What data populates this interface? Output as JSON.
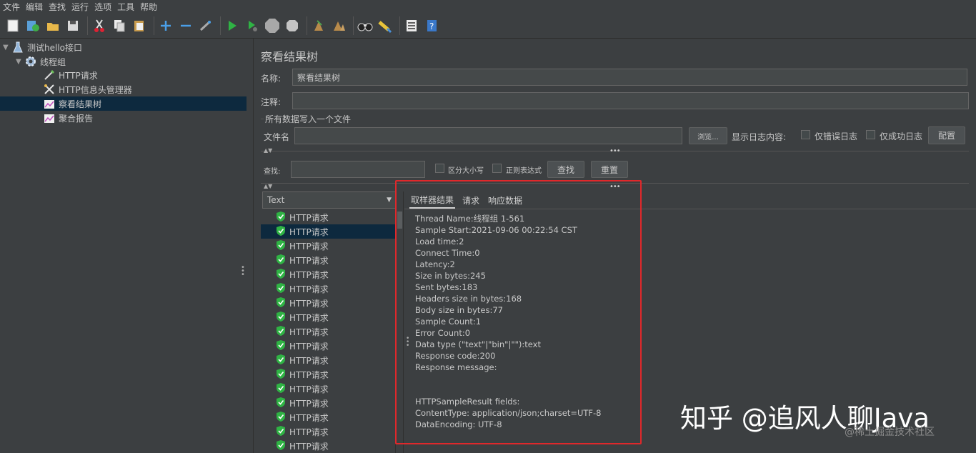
{
  "menu": [
    "文件",
    "编辑",
    "查找",
    "运行",
    "选项",
    "工具",
    "帮助"
  ],
  "toolbar_icons": [
    "new-icon",
    "templates-icon",
    "open-icon",
    "save-icon",
    "cut-icon",
    "copy-icon",
    "paste-icon",
    "expand-icon",
    "collapse-icon",
    "toggle-icon",
    "start-icon",
    "start-no-pause-icon",
    "stop-icon",
    "shutdown-icon",
    "clear-icon",
    "clear-all-icon",
    "search-icon",
    "reset-search-icon",
    "function-helper-icon",
    "help-icon"
  ],
  "tree": {
    "root": "测试hello接口",
    "thread_group": "线程组",
    "items": [
      "HTTP请求",
      "HTTP信息头管理器",
      "察看结果树",
      "聚合报告"
    ]
  },
  "panel": {
    "title": "察看结果树",
    "name_label": "名称:",
    "name_value": "察看结果树",
    "comment_label": "注释:",
    "comment_value": "",
    "write_all_label": "所有数据写入一个文件",
    "filename_label": "文件名",
    "filename_value": "",
    "browse_label": "浏览...",
    "log_label": "显示日志内容:",
    "errors_only_label": "仅错误日志",
    "success_only_label": "仅成功日志",
    "config_label": "配置"
  },
  "search": {
    "label": "查找:",
    "value": "",
    "case_label": "区分大小写",
    "regex_label": "正则表达式",
    "find_button": "查找",
    "reset_button": "重置"
  },
  "renderer": {
    "selected": "Text"
  },
  "samples": [
    "HTTP请求",
    "HTTP请求",
    "HTTP请求",
    "HTTP请求",
    "HTTP请求",
    "HTTP请求",
    "HTTP请求",
    "HTTP请求",
    "HTTP请求",
    "HTTP请求",
    "HTTP请求",
    "HTTP请求",
    "HTTP请求",
    "HTTP请求",
    "HTTP请求",
    "HTTP请求",
    "HTTP请求"
  ],
  "selected_sample_index": 1,
  "result_tabs": [
    "取样器结果",
    "请求",
    "响应数据"
  ],
  "result_lines": [
    "Thread Name:线程组 1-561",
    "Sample Start:2021-09-06 00:22:54 CST",
    "Load time:2",
    "Connect Time:0",
    "Latency:2",
    "Size in bytes:245",
    "Sent bytes:183",
    "Headers size in bytes:168",
    "Body size in bytes:77",
    "Sample Count:1",
    "Error Count:0",
    "Data type (\"text\"|\"bin\"|\"\"):text",
    "Response code:200",
    "Response message:",
    "",
    "",
    "HTTPSampleResult fields:",
    "ContentType: application/json;charset=UTF-8",
    "DataEncoding: UTF-8"
  ],
  "watermark": {
    "main": "知乎 @追风人聊Java",
    "sub": "@稀土掘金技术社区"
  },
  "colors": {
    "background": "#3c3f41",
    "selection": "#0d293e",
    "highlight_box": "#e0282b",
    "success_shield": "#2fb344"
  }
}
